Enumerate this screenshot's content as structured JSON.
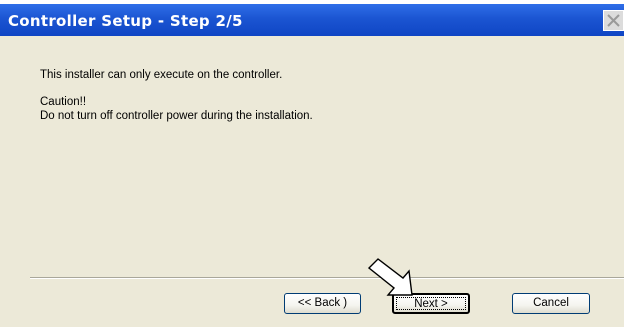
{
  "window": {
    "title": "Controller Setup - Step 2/5",
    "close_icon": "close-x-icon"
  },
  "content": {
    "line1": "This installer can only execute on the controller.",
    "line2": "Caution!!",
    "line3": "Do not turn off controller power during the installation."
  },
  "buttons": {
    "back_label": "<< Back )",
    "next_label": "Next >",
    "cancel_label": "Cancel"
  },
  "annotation": {
    "icon": "pointer-arrow-icon"
  },
  "colors": {
    "titlebar": "#1b55d2",
    "dialog_bg": "#ece9d8"
  }
}
